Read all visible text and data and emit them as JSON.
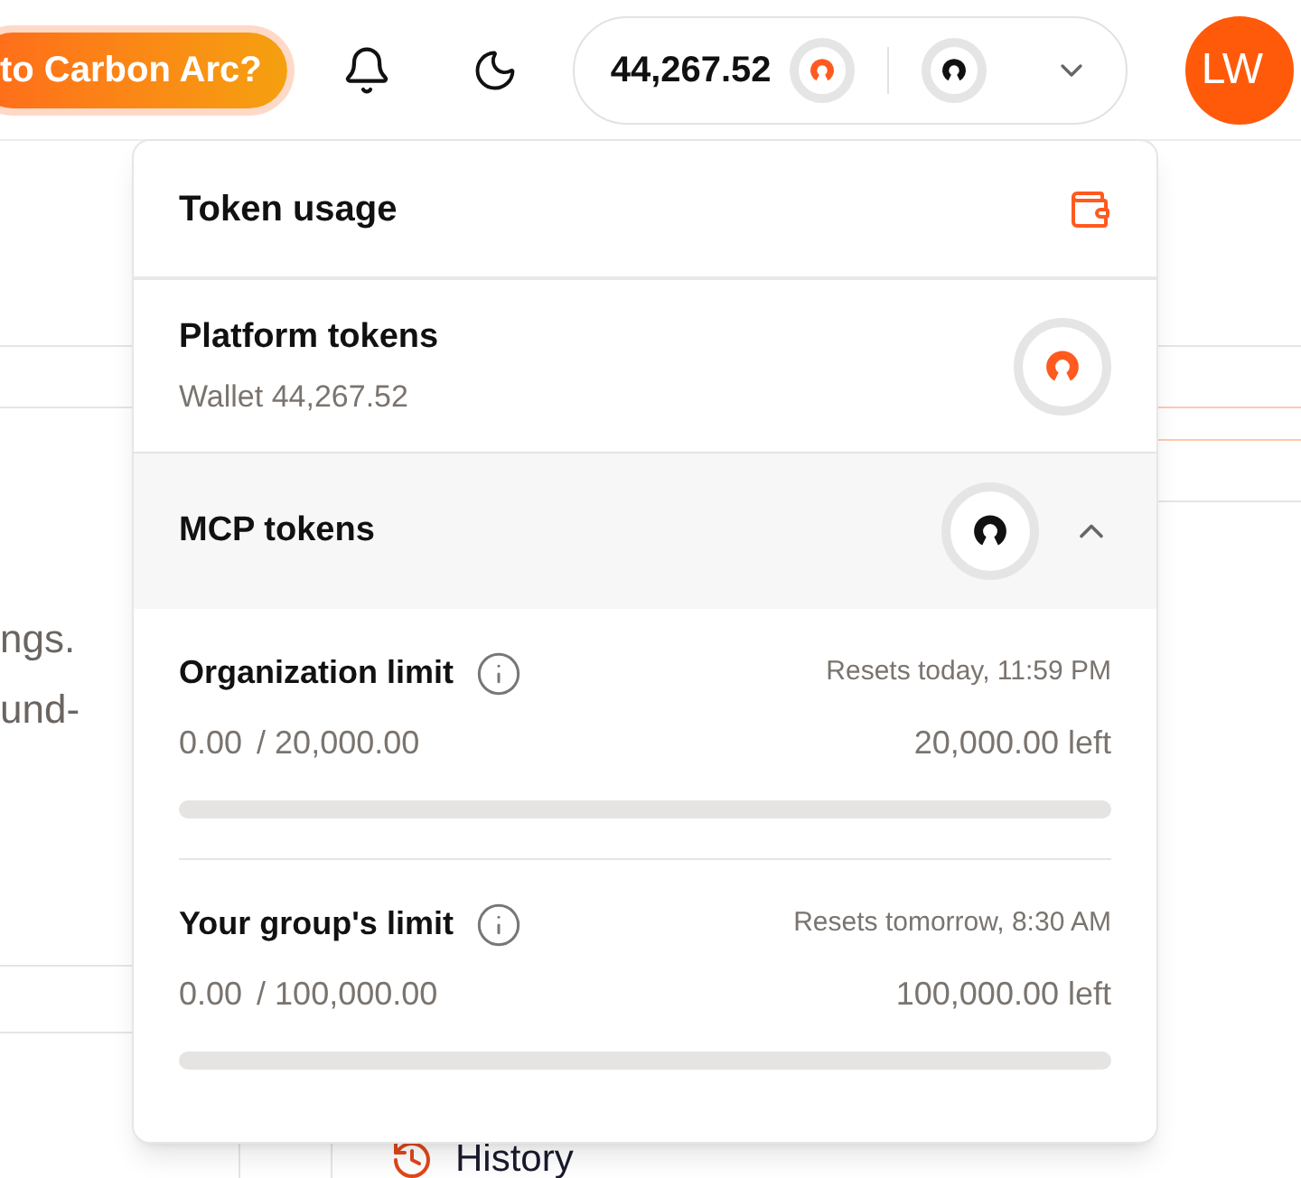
{
  "header": {
    "promo_button": "to Carbon Arc?",
    "balance": {
      "amount": "44,267.52",
      "expanded": false
    },
    "avatar": "LW"
  },
  "background": {
    "text_lines": [
      "ngs.",
      "und-"
    ],
    "nav_item": "History"
  },
  "token_menu": {
    "title": "Token usage",
    "platform": {
      "title": "Platform tokens",
      "wallet": "Wallet 44,267.52"
    },
    "mcp": {
      "title": "MCP tokens",
      "expanded": true,
      "limits": [
        {
          "name": "Organization limit",
          "resets": "Resets today, 11:59 PM",
          "used": "0.00",
          "total": "/ 20,000.00",
          "left": "20,000.00 left",
          "level": 0
        },
        {
          "name": "Your group's limit",
          "resets": "Resets tomorrow, 8:30 AM",
          "used": "0.00",
          "total": "/ 100,000.00",
          "left": "100,000.00 left",
          "level": 0
        }
      ]
    }
  }
}
